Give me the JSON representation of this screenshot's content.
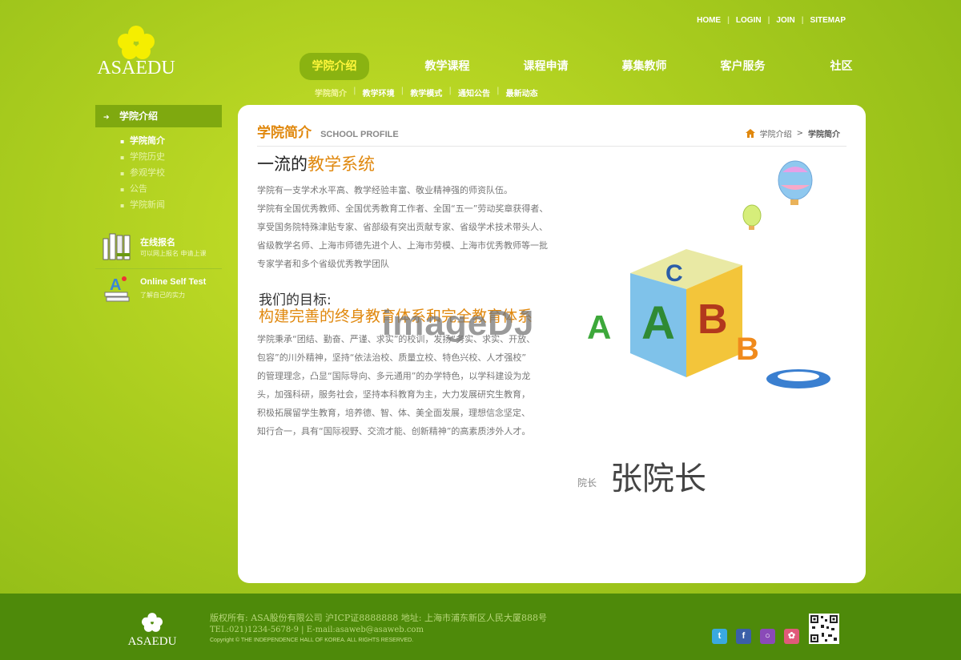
{
  "toplinks": [
    "HOME",
    "LOGIN",
    "JOIN",
    "SITEMAP"
  ],
  "logo": {
    "name": "ASAEDU"
  },
  "nav": {
    "items": [
      "学院介绍",
      "教学课程",
      "课程申请",
      "募集教师",
      "客户服务",
      "社区"
    ],
    "sub": [
      "学院简介",
      "教学环境",
      "教学模式",
      "通知公告",
      "最新动态"
    ]
  },
  "sidebar": {
    "title": "学院介绍",
    "items": [
      "学院简介",
      "学院历史",
      "参观学校",
      "公告",
      "学院新闻"
    ],
    "box1": {
      "title": "在线报名",
      "desc": "可以网上报名 申请上课"
    },
    "box2": {
      "title": "Online Self Test",
      "desc": "了解自己的实力"
    }
  },
  "panel": {
    "title_cn": "学院简介",
    "title_en": "SCHOOL PROFILE",
    "crumb": {
      "parent": "学院介绍",
      "sep": ">",
      "current": "学院简介"
    },
    "heading_a": "一流的",
    "heading_b": "教学系统",
    "para1": [
      "学院有一支学术水平高、教学经验丰富、敬业精神强的师资队伍。",
      "学院有全国优秀教师、全国优秀教育工作者、全国“五一”劳动奖章获得者、",
      "享受国务院特殊津贴专家、省部级有突出贡献专家、省级学术技术带头人、",
      "省级教学名师、上海市师德先进个人、上海市劳模、上海市优秀教师等一批",
      "专家学者和多个省级优秀教学团队"
    ],
    "goal_label": "我们的目标:",
    "goal_text": "构建完善的终身教育体系和完全教育体系",
    "para2": [
      "学院秉承“团结、勤奋、严谨、求实”的校训，发扬“务实、求实、开放、",
      "包容”的川外精神，坚持“依法治校、质量立校、特色兴校、人才强校”",
      "的管理理念，凸显“国际导向、多元通用”的办学特色，以学科建设为龙",
      "头，加强科研，服务社会，坚持本科教育为主，大力发展研究生教育，",
      "积极拓展留学生教育，培养德、智、体、美全面发展，理想信念坚定、",
      "知行合一，具有“国际视野、交流才能、创新精神”的高素质涉外人才。"
    ],
    "sign_label": "院长",
    "sign_name": "张院长",
    "watermark": "imageDJ"
  },
  "footer": {
    "logo": "ASAEDU",
    "line1": "版权所有: ASA股份有限公司 沪ICP证8888888 地址: 上海市浦东新区人民大厦888号",
    "line2": "TEL:021)1234-5678-9  |  E-mail:asaweb@asaweb.com",
    "line3": "Copyright © THE INDEPENDENCE HALL OF KOREA. ALL RIGHTS RESERVED.",
    "social": [
      "t",
      "f",
      "○",
      "✿"
    ]
  }
}
